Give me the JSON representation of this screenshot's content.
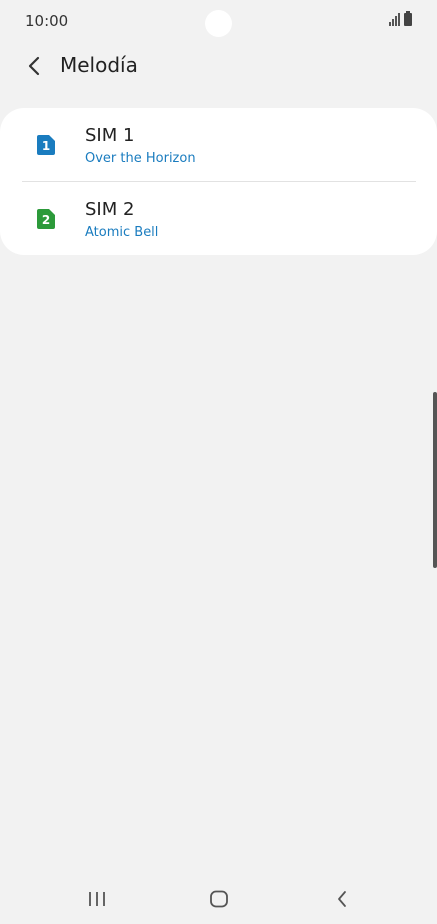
{
  "status_bar": {
    "time": "10:00",
    "icons": [
      "signal-icon",
      "battery-icon"
    ]
  },
  "header": {
    "title": "Melodía",
    "back_icon": "chevron-left-icon"
  },
  "sim_list": [
    {
      "title": "SIM 1",
      "subtitle": "Over the Horizon",
      "badge": "1",
      "color": "#1a7cbf"
    },
    {
      "title": "SIM 2",
      "subtitle": "Atomic Bell",
      "badge": "2",
      "color": "#2c9a3a"
    }
  ],
  "nav_bar": {
    "icons": [
      "recents-icon",
      "home-icon",
      "back-icon"
    ]
  },
  "colors": {
    "background": "#f2f2f2",
    "card": "#ffffff",
    "accent": "#1a7cbf"
  }
}
